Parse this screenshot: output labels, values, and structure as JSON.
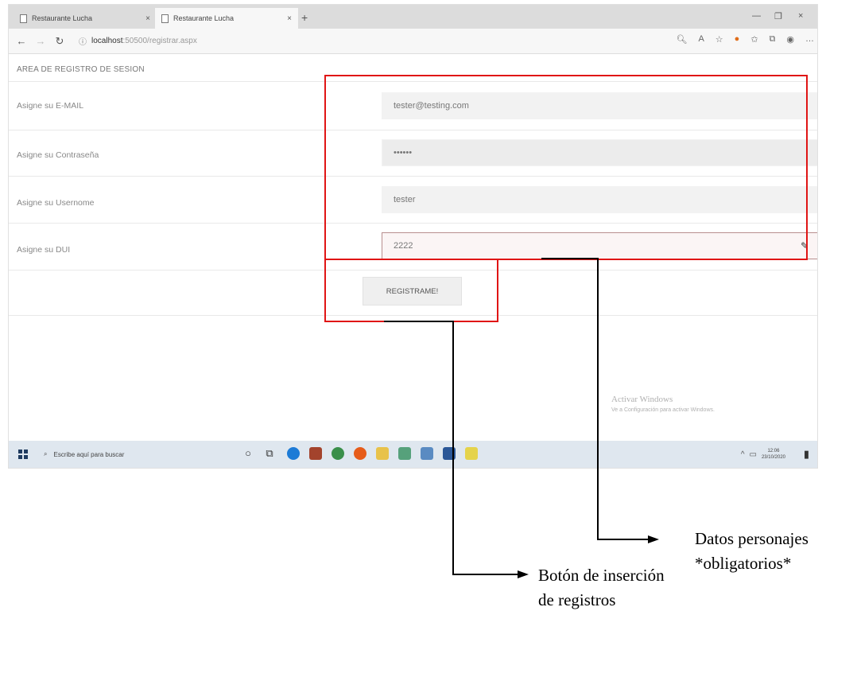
{
  "browser": {
    "tabs": [
      {
        "label": "Restaurante Lucha",
        "close": "×"
      },
      {
        "label": "Restaurante Lucha",
        "close": "×"
      }
    ],
    "new_tab": "+",
    "window_controls": {
      "minimize": "—",
      "maximize": "❐",
      "close": "×"
    },
    "nav": {
      "back": "←",
      "forward": "→",
      "refresh": "↻",
      "info": "ⓘ"
    },
    "url_host": "localhost",
    "url_path": ":50500/registrar.aspx",
    "toolbar_icons": [
      "zoom-icon",
      "reader-icon",
      "star-icon",
      "extension-icon",
      "favorites-icon",
      "collections-icon",
      "profile-icon",
      "more-icon"
    ]
  },
  "page": {
    "heading": "AREA DE REGISTRO DE SESION",
    "rows": [
      {
        "label": "Asigne su E-MAIL",
        "value": "tester@testing.com"
      },
      {
        "label": "Asigne su Contraseña",
        "value": "••••••"
      },
      {
        "label": "Asigne su Usernome",
        "value": "tester"
      },
      {
        "label": "Asigne su DUI",
        "value": "2222"
      }
    ],
    "submit_label": "REGISTRAME!"
  },
  "watermark": {
    "title": "Activar Windows",
    "subtitle": "Ve a Configuración para activar Windows."
  },
  "taskbar": {
    "search_placeholder": "Escribe aquí para buscar",
    "clock_time": "12:06",
    "clock_date": "23/10/2020"
  },
  "annotations": {
    "fields_caption_line1": "Datos personajes",
    "fields_caption_line2": "*obligatorios*",
    "button_caption_line1": "Botón de inserción",
    "button_caption_line2": "de registros",
    "box_color": "#e01515"
  }
}
